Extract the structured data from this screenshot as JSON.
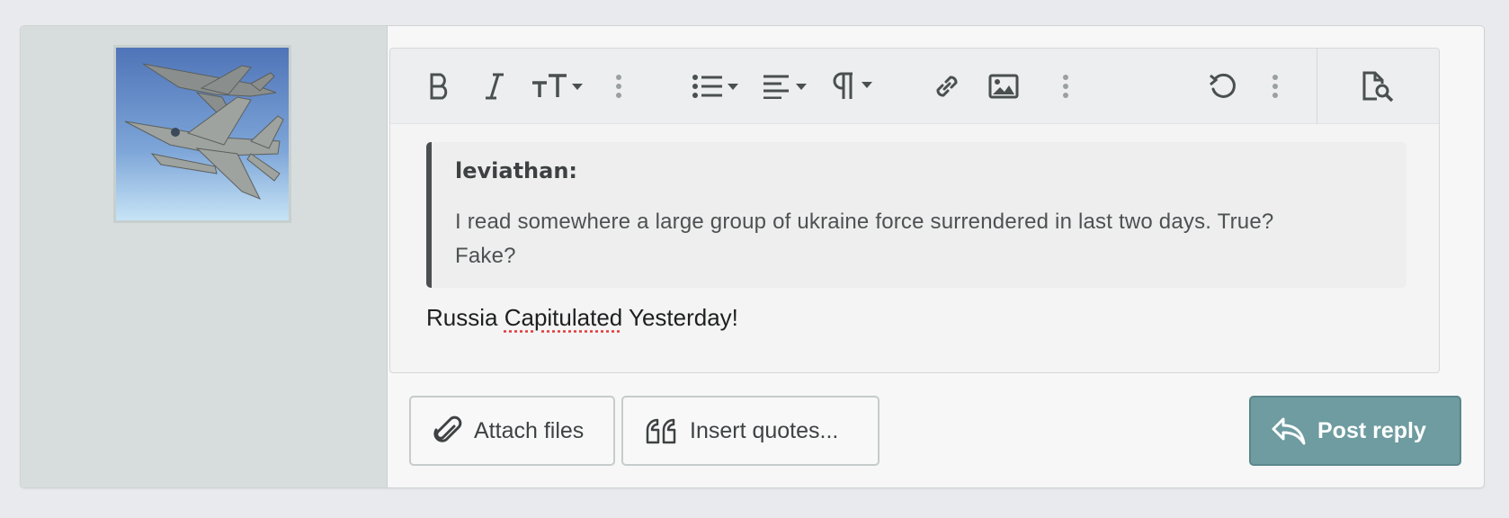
{
  "toolbar": {
    "icons": [
      "bold-icon",
      "italic-icon",
      "text-size-icon",
      "more-vertical-icon",
      "list-icon",
      "align-icon",
      "paragraph-icon",
      "link-icon",
      "image-icon",
      "more-vertical-icon",
      "undo-icon",
      "more-vertical-icon",
      "preview-icon"
    ]
  },
  "quote": {
    "author": "leviathan:",
    "text_line1": "I read somewhere a large group of ukraine force surrendered in last two days. True?",
    "text_line2": "Fake?"
  },
  "reply": {
    "part1": "Russia ",
    "part2": "Capitulated",
    "part3": " Yesterday!"
  },
  "buttons": {
    "attach_label": "Attach files",
    "quotes_label": "Insert quotes...",
    "post_label": "Post reply"
  },
  "colors": {
    "accent": "#6e9ca0",
    "sidebar_bg": "#d7dddd",
    "quote_border": "#4a4f50"
  }
}
